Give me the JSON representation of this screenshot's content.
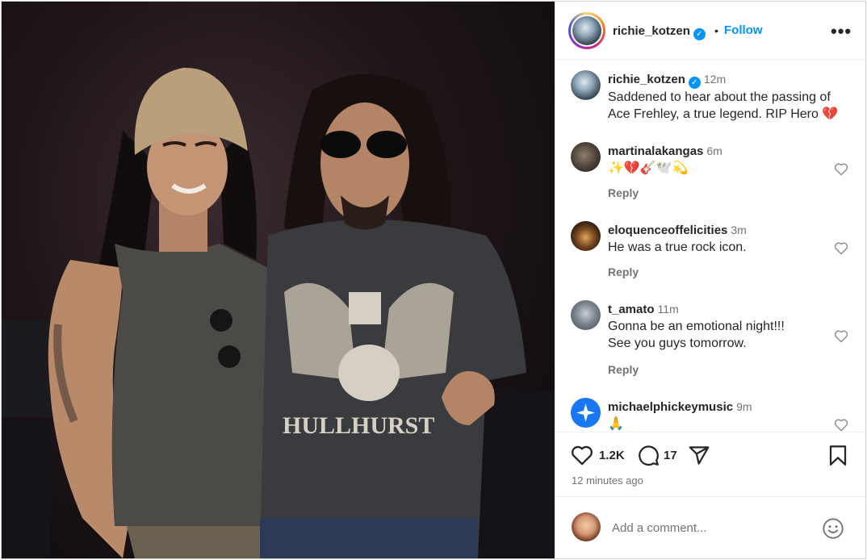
{
  "post": {
    "author": "richie_kotzen",
    "follow_label": "Follow",
    "separator": "•",
    "more_label": "•••",
    "caption_time": "12m",
    "caption_line1": "Saddened to hear about the passing of",
    "caption_line2": "Ace Frehley,  a true legend.  RIP Hero 💔",
    "likes": "1.2K",
    "comment_count": "17",
    "posted_ago": "12 minutes ago"
  },
  "comments": [
    {
      "user": "martinalakangas",
      "time": "6m",
      "line1": "✨💔🎸🕊️💫",
      "line2": "",
      "reply": "Reply"
    },
    {
      "user": "eloquenceoffelicities",
      "time": "3m",
      "line1": "He was a true rock icon.",
      "line2": "",
      "reply": "Reply"
    },
    {
      "user": "t_amato",
      "time": "11m",
      "line1": "Gonna be an emotional night!!!",
      "line2": "See you guys tomorrow.",
      "reply": "Reply"
    },
    {
      "user": "michaelphickeymusic",
      "time": "9m",
      "line1": "🙏",
      "line2": "",
      "reply": ""
    }
  ],
  "add_comment": {
    "placeholder": "Add a comment..."
  },
  "colors": {
    "accent": "#0095f6",
    "text": "#262626",
    "muted": "#737373",
    "divider": "#efefef"
  },
  "icons": {
    "verified": "verified-badge-icon",
    "like": "heart-icon",
    "comment": "comment-bubble-icon",
    "share": "paper-plane-icon",
    "save": "bookmark-icon",
    "emoji": "emoji-smiley-icon",
    "more": "more-options-icon"
  }
}
